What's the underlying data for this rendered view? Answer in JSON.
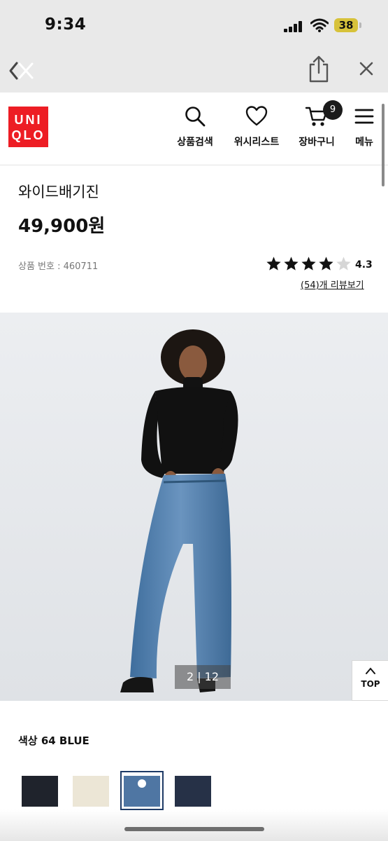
{
  "status_bar": {
    "time": "9:34",
    "battery": "38",
    "battery_color": "#d7c23a"
  },
  "browser": {
    "back_icon": "back-close-icon",
    "share_icon": "share-icon",
    "close_icon": "close-icon"
  },
  "header": {
    "logo_line1": "UNI",
    "logo_line2": "QLO",
    "brand_color": "#ed1d24",
    "nav": {
      "search": "상품검색",
      "wishlist": "위시리스트",
      "cart": "장바구니",
      "menu": "메뉴"
    },
    "cart_count": "9"
  },
  "product": {
    "name": "와이드배기진",
    "price": "49,900원",
    "code": "상품 번호 : 460711",
    "rating_value": "4.3",
    "rating": 4.3,
    "rating_max": 5,
    "review_link": "(54)개 리뷰보기"
  },
  "gallery": {
    "counter": "2 | 12",
    "top_label": "TOP"
  },
  "color": {
    "label": "색상  64 BLUE",
    "swatches": [
      {
        "name": "black",
        "color": "#1f232c"
      },
      {
        "name": "off-white",
        "color": "#ece6d6"
      },
      {
        "name": "blue",
        "color": "#4f76a3",
        "selected": true
      },
      {
        "name": "navy",
        "color": "#263147"
      }
    ]
  }
}
